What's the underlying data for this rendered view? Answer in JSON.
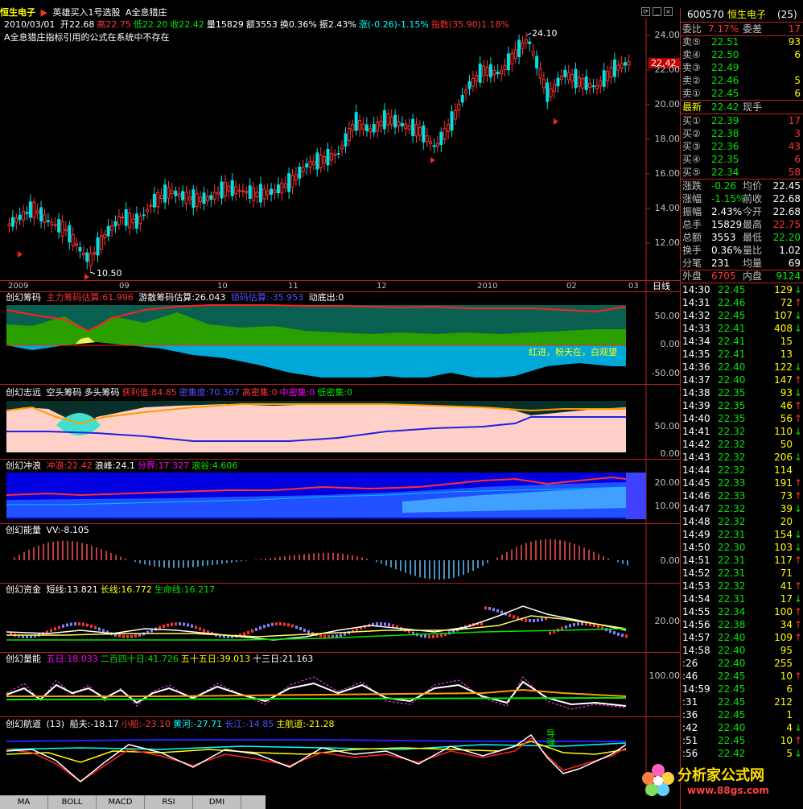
{
  "header": {
    "stock_name": "恒生电子",
    "formula_list": "英雄买入1号选股",
    "formula_current": "A全息猎庄",
    "date": "2010/03/01",
    "open": "开22.68",
    "high": "高22.75",
    "low": "低22.20",
    "close": "收22.42",
    "volume": "量15829",
    "amount": "额3553",
    "turnover": "换0.36%",
    "amplitude": "振2.43%",
    "change": "涨(-0.26)-1.15%",
    "index": "指数(35.90)1.18%",
    "warning": "A全息猎庄指标引用的公式在系统中不存在"
  },
  "main_chart": {
    "y_axis": [
      "24.00",
      "22.00",
      "20.00",
      "18.00",
      "16.00",
      "14.00",
      "12.00"
    ],
    "current_price": "22.42",
    "high_label": "24.10",
    "low_label": "10.50",
    "x_axis": [
      "2009",
      "09",
      "10",
      "11",
      "12",
      "2010",
      "02",
      "03"
    ],
    "period": "日线"
  },
  "panels": {
    "chouma": {
      "title": "创幻筹码",
      "v1": "主力筹码估算:61.996",
      "v2": "游散筹码估算:26.043",
      "v3": "锁码估算:-35.953",
      "v4": "动底出:0",
      "note": "红进，粉夭在，白观望",
      "axis": [
        "50.00",
        "0.00",
        "-50.00"
      ]
    },
    "zhiyuan": {
      "title": "创幻志远",
      "v1": "空头筹码",
      "v2": "多头筹码",
      "v3": "获利值:84.85",
      "v4": "密集度:70.367",
      "v5": "高密集:0",
      "v6": "中密集:0",
      "v7": "低密集:0",
      "axis": [
        "50.00",
        "0.00"
      ]
    },
    "chonglang": {
      "title": "创幻冲浪",
      "v1": "冲浪:22.42",
      "v2": "浪峰:24.1",
      "v3": "分界:17.327",
      "v4": "浪谷:4.606",
      "axis": [
        "20.00",
        "10.00"
      ]
    },
    "nengliang": {
      "title": "创幻能量",
      "v1": "VV:-8.105",
      "axis": [
        "0.00"
      ]
    },
    "zijin": {
      "title": "创幻资金",
      "v1": "短线:13.821",
      "v2": "长线:16.772",
      "v3": "生命线:16.217",
      "axis": [
        "20.00"
      ]
    },
    "liangneng": {
      "title": "创幻量能",
      "v1": "五日:18.033",
      "v2": "二百四十日:41.726",
      "v3": "五十五日:39.013",
      "v4": "十三日:21.163",
      "axis": [
        "100.00"
      ]
    },
    "hangdao": {
      "title": "创幻航道",
      "param": "(13)",
      "v1": "船夫:-18.17",
      "v2": "小船:-23.10",
      "v3": "黄河:-27.71",
      "v4": "长江:-14.85",
      "v5": "主航道:-21.28",
      "mark": "导弹"
    }
  },
  "quote": {
    "code": "600570",
    "name": "恒生电子",
    "count": "(25)",
    "weibi_label": "委比",
    "weibi": "7.17%",
    "weicha_label": "委差",
    "weicha": "17",
    "sells": [
      {
        "label": "卖⑤",
        "price": "22.51",
        "vol": "93"
      },
      {
        "label": "卖④",
        "price": "22.50",
        "vol": "6"
      },
      {
        "label": "卖③",
        "price": "22.49",
        "vol": ""
      },
      {
        "label": "卖②",
        "price": "22.46",
        "vol": "5"
      },
      {
        "label": "卖①",
        "price": "22.45",
        "vol": "6"
      }
    ],
    "latest_label": "最新",
    "latest": "22.42",
    "hand_label": "现手",
    "buys": [
      {
        "label": "买①",
        "price": "22.39",
        "vol": "17"
      },
      {
        "label": "买②",
        "price": "22.38",
        "vol": "3"
      },
      {
        "label": "买③",
        "price": "22.36",
        "vol": "43"
      },
      {
        "label": "买④",
        "price": "22.35",
        "vol": "6"
      },
      {
        "label": "买⑤",
        "price": "22.34",
        "vol": "58"
      }
    ],
    "stats": [
      {
        "l1": "涨跌",
        "v1": "-0.26",
        "l2": "均价",
        "v2": "22.45",
        "c1": "grn",
        "c2": "wht"
      },
      {
        "l1": "涨幅",
        "v1": "-1.15%",
        "l2": "前收",
        "v2": "22.68",
        "c1": "grn",
        "c2": "wht"
      },
      {
        "l1": "振幅",
        "v1": "2.43%",
        "l2": "今开",
        "v2": "22.68",
        "c1": "wht",
        "c2": "wht"
      },
      {
        "l1": "总手",
        "v1": "15829",
        "l2": "最高",
        "v2": "22.75",
        "c1": "wht",
        "c2": "red"
      },
      {
        "l1": "总额",
        "v1": "3553",
        "l2": "最低",
        "v2": "22.20",
        "c1": "wht",
        "c2": "grn"
      },
      {
        "l1": "换手",
        "v1": "0.36%",
        "l2": "量比",
        "v2": "1.02",
        "c1": "wht",
        "c2": "wht"
      },
      {
        "l1": "分笔",
        "v1": "231",
        "l2": "均量",
        "v2": "69",
        "c1": "wht",
        "c2": "wht"
      }
    ],
    "outer_label": "外盘",
    "outer": "6705",
    "inner_label": "内盘",
    "inner": "9124"
  },
  "ticks": [
    {
      "t": "14:30",
      "p": "22.45",
      "v": "129",
      "d": "↓",
      "c": "grn"
    },
    {
      "t": "14:31",
      "p": "22.46",
      "v": "72",
      "d": "↑",
      "c": "red"
    },
    {
      "t": "14:32",
      "p": "22.45",
      "v": "107",
      "d": "↓",
      "c": "grn"
    },
    {
      "t": "14:33",
      "p": "22.41",
      "v": "408",
      "d": "↓",
      "c": "grn"
    },
    {
      "t": "14:34",
      "p": "22.41",
      "v": "15",
      "d": "",
      "c": "grn"
    },
    {
      "t": "14:35",
      "p": "22.41",
      "v": "13",
      "d": "",
      "c": "grn"
    },
    {
      "t": "14:36",
      "p": "22.40",
      "v": "122",
      "d": "↓",
      "c": "grn"
    },
    {
      "t": "14:37",
      "p": "22.40",
      "v": "147",
      "d": "↑",
      "c": "red"
    },
    {
      "t": "14:38",
      "p": "22.35",
      "v": "93",
      "d": "↓",
      "c": "grn"
    },
    {
      "t": "14:39",
      "p": "22.35",
      "v": "46",
      "d": "↑",
      "c": "red"
    },
    {
      "t": "14:40",
      "p": "22.35",
      "v": "56",
      "d": "↑",
      "c": "red"
    },
    {
      "t": "14:41",
      "p": "22.32",
      "v": "110",
      "d": "↓",
      "c": "grn"
    },
    {
      "t": "14:42",
      "p": "22.32",
      "v": "50",
      "d": "",
      "c": "grn"
    },
    {
      "t": "14:43",
      "p": "22.32",
      "v": "206",
      "d": "↓",
      "c": "grn"
    },
    {
      "t": "14:44",
      "p": "22.32",
      "v": "114",
      "d": "",
      "c": "grn"
    },
    {
      "t": "14:45",
      "p": "22.33",
      "v": "191",
      "d": "↑",
      "c": "red"
    },
    {
      "t": "14:46",
      "p": "22.33",
      "v": "73",
      "d": "↑",
      "c": "red"
    },
    {
      "t": "14:47",
      "p": "22.32",
      "v": "39",
      "d": "↓",
      "c": "grn"
    },
    {
      "t": "14:48",
      "p": "22.32",
      "v": "20",
      "d": "",
      "c": "grn"
    },
    {
      "t": "14:49",
      "p": "22.31",
      "v": "154",
      "d": "↓",
      "c": "grn"
    },
    {
      "t": "14:50",
      "p": "22.30",
      "v": "103",
      "d": "↓",
      "c": "grn"
    },
    {
      "t": "14:51",
      "p": "22.31",
      "v": "117",
      "d": "↑",
      "c": "red"
    },
    {
      "t": "14:52",
      "p": "22.31",
      "v": "71",
      "d": "",
      "c": "red"
    },
    {
      "t": "14:53",
      "p": "22.32",
      "v": "41",
      "d": "↑",
      "c": "red"
    },
    {
      "t": "14:54",
      "p": "22.31",
      "v": "17",
      "d": "↓",
      "c": "grn"
    },
    {
      "t": "14:55",
      "p": "22.34",
      "v": "100",
      "d": "↑",
      "c": "red"
    },
    {
      "t": "14:56",
      "p": "22.38",
      "v": "34",
      "d": "↑",
      "c": "red"
    },
    {
      "t": "14:57",
      "p": "22.40",
      "v": "109",
      "d": "↑",
      "c": "red"
    },
    {
      "t": "14:58",
      "p": "22.40",
      "v": "95",
      "d": "",
      "c": "red"
    },
    {
      "t": ":26",
      "p": "22.40",
      "v": "255",
      "d": "",
      "c": "red"
    },
    {
      "t": ":46",
      "p": "22.45",
      "v": "10",
      "d": "↑",
      "c": "red"
    },
    {
      "t": "14:59",
      "p": "22.45",
      "v": "6",
      "d": "",
      "c": "red"
    },
    {
      "t": ":31",
      "p": "22.45",
      "v": "212",
      "d": "",
      "c": "red"
    },
    {
      "t": ":36",
      "p": "22.45",
      "v": "1",
      "d": "",
      "c": "red"
    },
    {
      "t": ":42",
      "p": "22.40",
      "v": "4",
      "d": "↓",
      "c": "grn"
    },
    {
      "t": ":51",
      "p": "22.45",
      "v": "10",
      "d": "↑",
      "c": "red"
    },
    {
      "t": ":56",
      "p": "22.42",
      "v": "5",
      "d": "↓",
      "c": "grn"
    }
  ],
  "tabs": [
    "MA",
    "BOLL",
    "MACD",
    "RSI",
    "DMI"
  ],
  "colors": {
    "red": "#ff3232",
    "green": "#00e600",
    "cyan": "#00ffff",
    "yellow": "#ffff00",
    "magenta": "#ff00ff",
    "border": "#b22222"
  }
}
